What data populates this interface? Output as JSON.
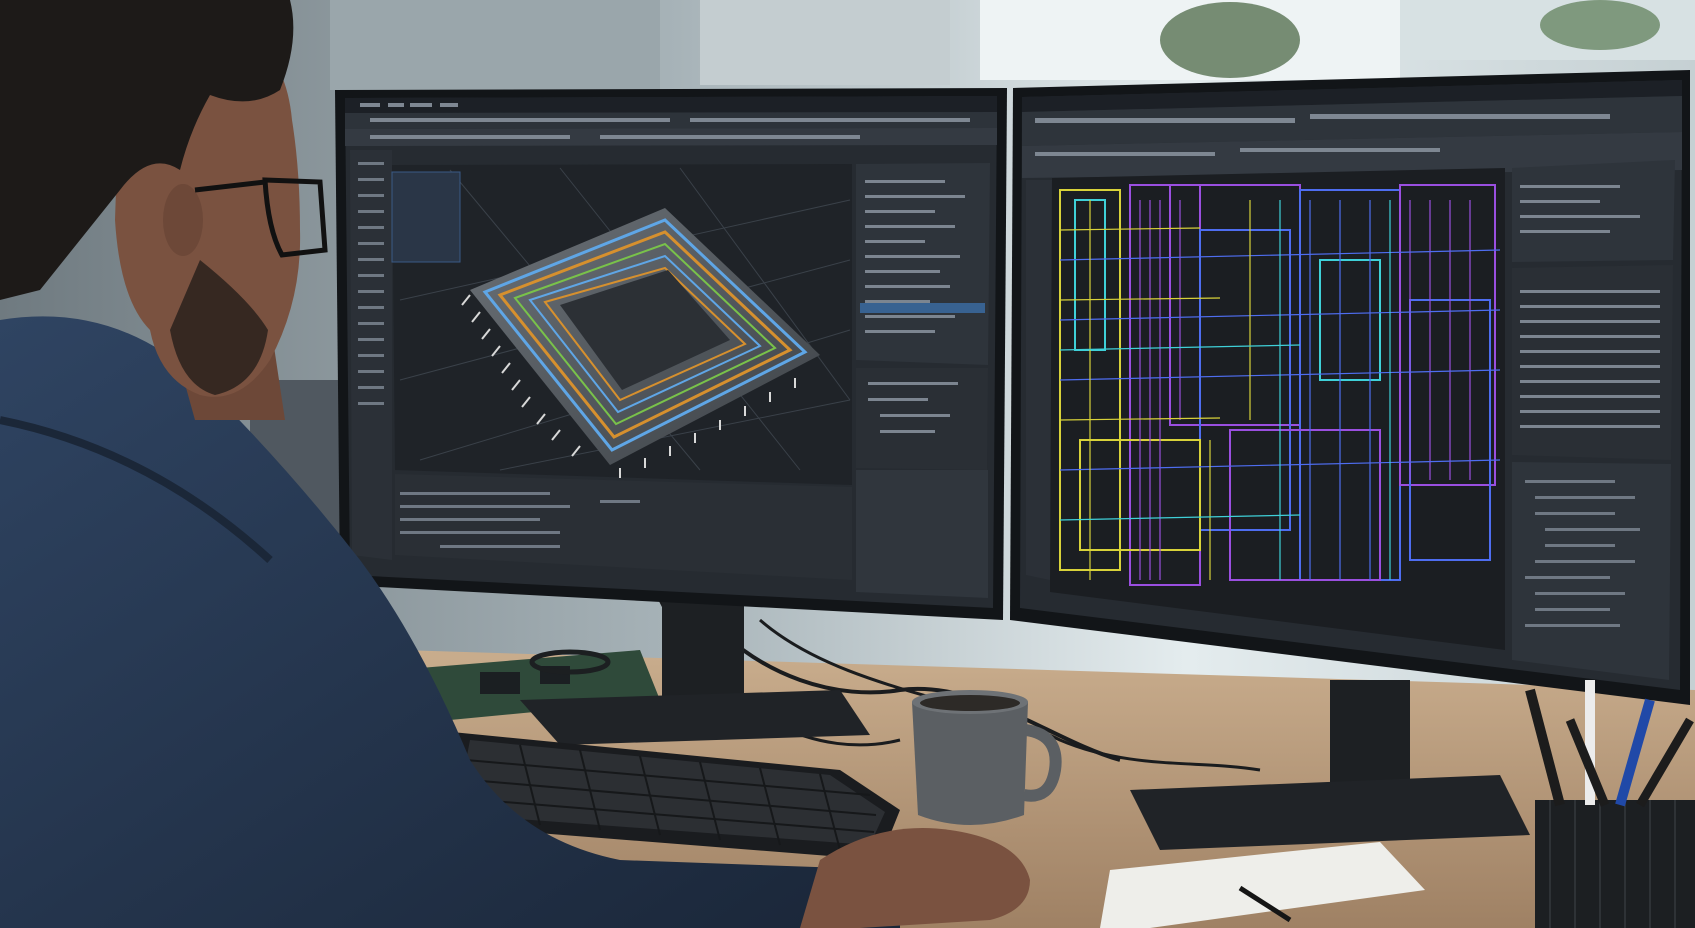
{
  "scene": {
    "description_label": "",
    "colors": {
      "wall": "#8e9aa3",
      "window": "#dfe7ea",
      "desk": "#b99c7e",
      "shirt": "#2b3d55",
      "skin": "#7a5240",
      "hair": "#1d1a18",
      "monitor_bezel": "#15181b",
      "screen_bg": "#262b31",
      "panel_bg": "#2e343b",
      "chip_green": "#79c24a",
      "chip_orange": "#d6902e",
      "chip_blue": "#5fa6e6",
      "layout_purple": "#9a4fe0",
      "layout_blue": "#4e6df0",
      "layout_cyan": "#3fd0d8",
      "layout_yellow": "#d8d23a",
      "mug": "#5b5f63"
    },
    "icons": [
      "monitor-left",
      "monitor-right",
      "keyboard",
      "mug",
      "pen-cup",
      "notepad",
      "circuit-board"
    ]
  }
}
